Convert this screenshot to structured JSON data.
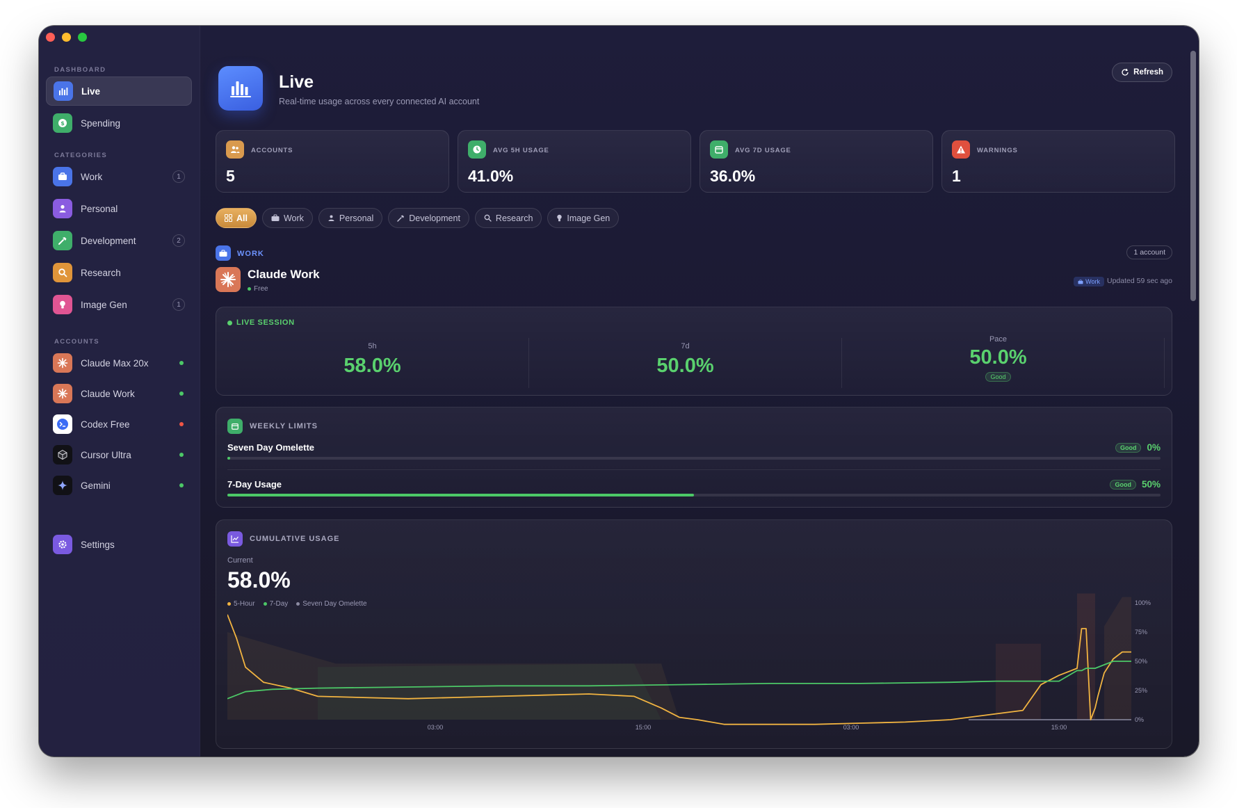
{
  "sidebar": {
    "sections": {
      "dashboard": "DASHBOARD",
      "categories": "CATEGORIES",
      "accounts": "ACCOUNTS"
    },
    "dashboard": [
      {
        "label": "Live",
        "icon": "bar-chart-icon",
        "color": "#4a74e8"
      },
      {
        "label": "Spending",
        "icon": "dollar-icon",
        "color": "#3fae6a"
      }
    ],
    "categories": [
      {
        "label": "Work",
        "count": "1",
        "icon": "briefcase-icon",
        "color": "#4a74e8"
      },
      {
        "label": "Personal",
        "count": "",
        "icon": "person-icon",
        "color": "#8a5ce0"
      },
      {
        "label": "Development",
        "count": "2",
        "icon": "hammer-icon",
        "color": "#3fae6a"
      },
      {
        "label": "Research",
        "count": "",
        "icon": "magnifier-icon",
        "color": "#e0953a"
      },
      {
        "label": "Image Gen",
        "count": "1",
        "icon": "lightbulb-icon",
        "color": "#e05593"
      }
    ],
    "accounts": [
      {
        "label": "Claude Max 20x",
        "status_color": "#4cc867"
      },
      {
        "label": "Claude Work",
        "status_color": "#4cc867"
      },
      {
        "label": "Codex Free",
        "status_color": "#f05545"
      },
      {
        "label": "Cursor Ultra",
        "status_color": "#4cc867"
      },
      {
        "label": "Gemini",
        "status_color": "#4cc867"
      }
    ],
    "settings": "Settings"
  },
  "header": {
    "title": "Live",
    "subtitle": "Real-time usage across every connected AI account",
    "refresh": "Refresh"
  },
  "stats": [
    {
      "label": "ACCOUNTS",
      "value": "5",
      "color": "#d99a4e"
    },
    {
      "label": "AVG 5H USAGE",
      "value": "41.0%",
      "color": "#3fae6a"
    },
    {
      "label": "AVG 7D USAGE",
      "value": "36.0%",
      "color": "#3fae6a"
    },
    {
      "label": "WARNINGS",
      "value": "1",
      "color": "#e0503e"
    }
  ],
  "filters": [
    "All",
    "Work",
    "Personal",
    "Development",
    "Research",
    "Image Gen"
  ],
  "group": {
    "label": "WORK",
    "count": "1 account",
    "account": {
      "name": "Claude Work",
      "plan": "Free",
      "tag": "Work",
      "updated": "Updated 59 sec ago"
    }
  },
  "live_session": {
    "label": "LIVE SESSION",
    "metrics": [
      {
        "caption": "5h",
        "value": "58.0%",
        "badge": ""
      },
      {
        "caption": "7d",
        "value": "50.0%",
        "badge": ""
      },
      {
        "caption": "Pace",
        "value": "50.0%",
        "badge": "Good"
      }
    ]
  },
  "weekly_limits": {
    "label": "WEEKLY LIMITS",
    "rows": [
      {
        "name": "Seven Day Omelette",
        "badge": "Good",
        "value": "0%",
        "fraction": 0
      },
      {
        "name": "7-Day Usage",
        "badge": "Good",
        "value": "50%",
        "fraction": 0.5
      }
    ]
  },
  "cumulative": {
    "label": "CUMULATIVE USAGE",
    "current_label": "Current",
    "current_value": "58.0%"
  },
  "chart_data": {
    "type": "line",
    "x_tick_labels": [
      "03:00",
      "15:00",
      "03:00",
      "15:00"
    ],
    "y_tick_labels": [
      "100%",
      "75%",
      "50%",
      "25%",
      "0%"
    ],
    "ylim": [
      0,
      100
    ],
    "legend": "top-left",
    "grid": false,
    "series": [
      {
        "name": "5-Hour",
        "color": "#f2b441",
        "t": [
          0,
          0.01,
          0.02,
          0.04,
          0.07,
          0.1,
          0.15,
          0.2,
          0.25,
          0.3,
          0.35,
          0.4,
          0.45,
          0.48,
          0.5,
          0.52,
          0.55,
          0.6,
          0.65,
          0.7,
          0.75,
          0.8,
          0.85,
          0.88,
          0.9,
          0.92,
          0.94,
          0.945,
          0.95,
          0.955,
          0.96,
          0.963,
          0.97,
          0.98,
          0.99,
          1.0
        ],
        "values": [
          90,
          70,
          45,
          32,
          27,
          20,
          19,
          18,
          19,
          20,
          21,
          22,
          20,
          10,
          2,
          0,
          -4,
          -4,
          -4,
          -3,
          -2,
          0,
          5,
          8,
          30,
          38,
          44,
          78,
          78,
          0,
          10,
          20,
          40,
          52,
          58,
          58
        ]
      },
      {
        "name": "7-Day",
        "color": "#4cc867",
        "t": [
          0,
          0.02,
          0.05,
          0.1,
          0.2,
          0.3,
          0.4,
          0.5,
          0.6,
          0.7,
          0.8,
          0.85,
          0.88,
          0.9,
          0.92,
          0.94,
          0.945,
          0.95,
          0.96,
          0.97,
          0.98,
          0.99,
          1.0
        ],
        "values": [
          18,
          24,
          26,
          27,
          28,
          29,
          29,
          30,
          31,
          31,
          32,
          33,
          33,
          33,
          33,
          42,
          42,
          44,
          44,
          47,
          50,
          50,
          50
        ]
      },
      {
        "name": "Seven Day Omelette",
        "color": "#8c8ba2",
        "t": [
          0,
          1.0
        ],
        "values": [
          0,
          0
        ]
      }
    ]
  }
}
